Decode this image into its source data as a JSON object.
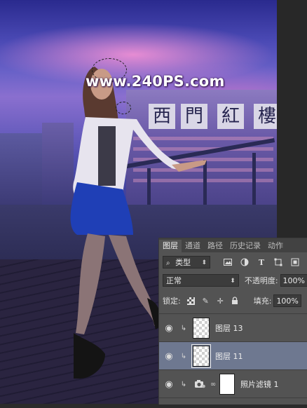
{
  "watermark": "www.240PS.com",
  "sign_chars": [
    "西",
    "門",
    "紅",
    "樓"
  ],
  "tabs": [
    "图层",
    "通道",
    "路径",
    "历史记录",
    "动作"
  ],
  "filter": {
    "kind_label": "类型",
    "kind_icon": "search-icon"
  },
  "blend": {
    "mode": "正常",
    "opacity_label": "不透明度:",
    "opacity_value": "100%"
  },
  "lock": {
    "label": "锁定:",
    "fill_label": "填充:",
    "fill_value": "100%"
  },
  "layers": [
    {
      "name": "图层 13",
      "selected": false,
      "clipped": true
    },
    {
      "name": "图层 11",
      "selected": true,
      "clipped": true
    },
    {
      "name": "照片滤镜 1",
      "selected": false,
      "clipped": true,
      "adjustment": true
    }
  ],
  "colors": {
    "panel_bg": "#535353",
    "tab_bar": "#424242",
    "selected_layer": "#6e7890",
    "sky_glow": "#ff96d7"
  }
}
